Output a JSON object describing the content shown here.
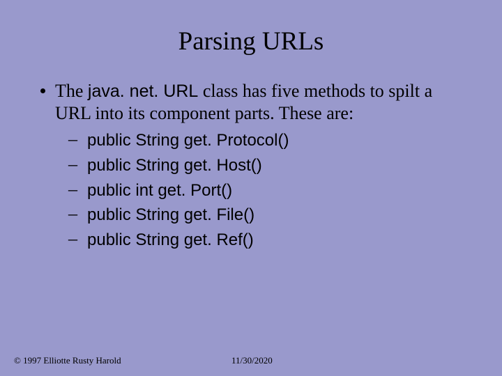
{
  "title": "Parsing URLs",
  "bullet_pre": "The ",
  "bullet_code": "java. net. URL",
  "bullet_post": " class has five methods to spilt a URL into its component parts. These are:",
  "methods": [
    "public String get. Protocol()",
    "public String get. Host()",
    "public int get. Port()",
    "public String get. File()",
    "public String get. Ref()"
  ],
  "footer": {
    "copyright": "© 1997 Elliotte Rusty Harold",
    "date": "11/30/2020"
  }
}
